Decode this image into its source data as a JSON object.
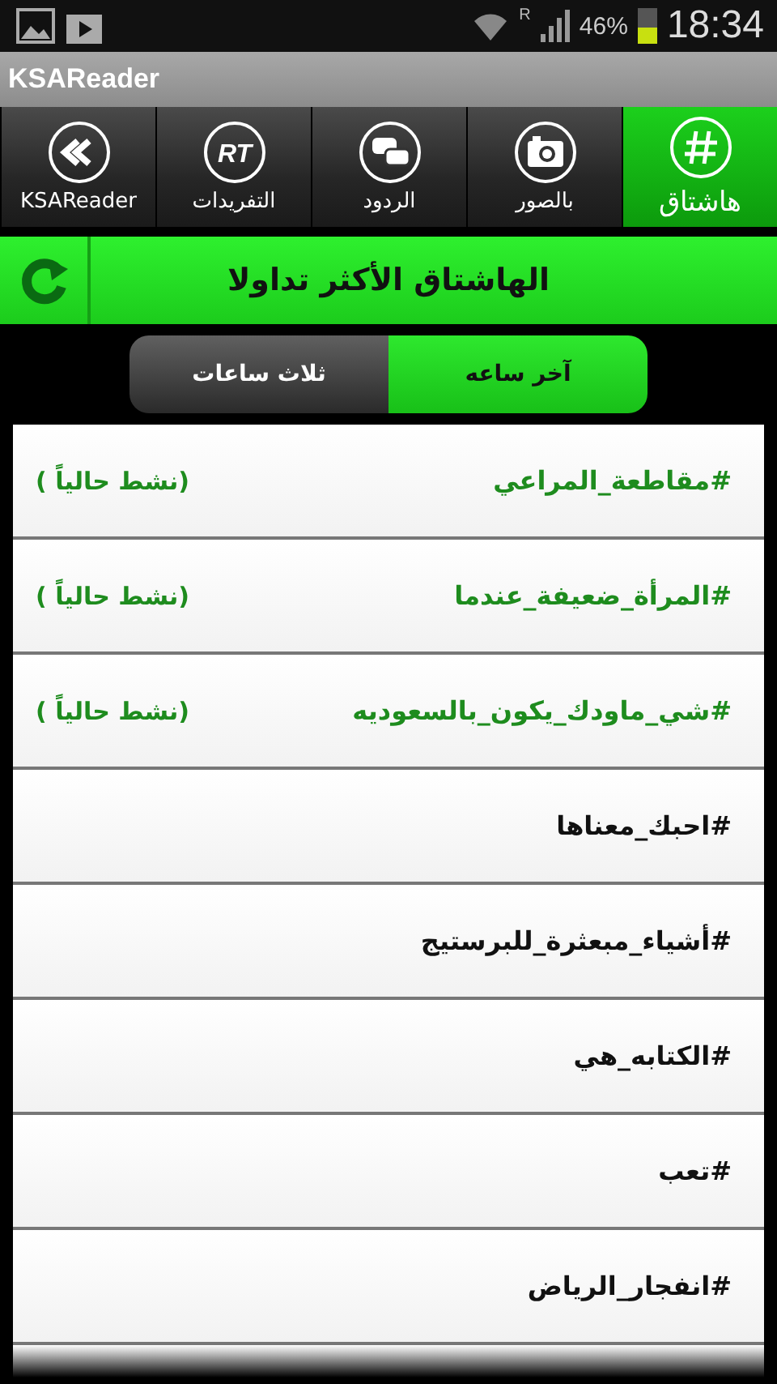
{
  "status_bar": {
    "roaming": "R",
    "battery_text": "46%",
    "time": "18:34"
  },
  "window": {
    "title": "KSAReader"
  },
  "tabs": [
    {
      "kind": "hash",
      "label": "هاشتاق",
      "selected": true
    },
    {
      "kind": "camera",
      "label": "بالصور",
      "selected": false
    },
    {
      "kind": "chat",
      "label": "الردود",
      "selected": false
    },
    {
      "kind": "rt",
      "icon_text": "RT",
      "label": "التفريدات",
      "selected": false
    },
    {
      "kind": "back",
      "label": "KSAReader",
      "selected": false
    }
  ],
  "header": {
    "title": "الهاشتاق الأكثر تداولا"
  },
  "segments": [
    {
      "label": "آخر ساعه",
      "selected": true
    },
    {
      "label": "ثلاث ساعات",
      "selected": false
    }
  ],
  "hashtags": [
    {
      "text": "#مقاطعة_المراعي",
      "active": true,
      "status": "(نشط حالياً )"
    },
    {
      "text": "#المرأة_ضعيفة_عندما",
      "active": true,
      "status": "(نشط حالياً )"
    },
    {
      "text": "#شي_ماودك_يكون_بالسعوديه",
      "active": true,
      "status": "(نشط حالياً )"
    },
    {
      "text": "#احبك_معناها",
      "active": false
    },
    {
      "text": "#أشياء_مبعثرة_للبرستيج",
      "active": false
    },
    {
      "text": "#الكتابه_هي",
      "active": false
    },
    {
      "text": "#تعب",
      "active": false
    },
    {
      "text": "#انفجار_الرياض",
      "active": false
    }
  ]
}
